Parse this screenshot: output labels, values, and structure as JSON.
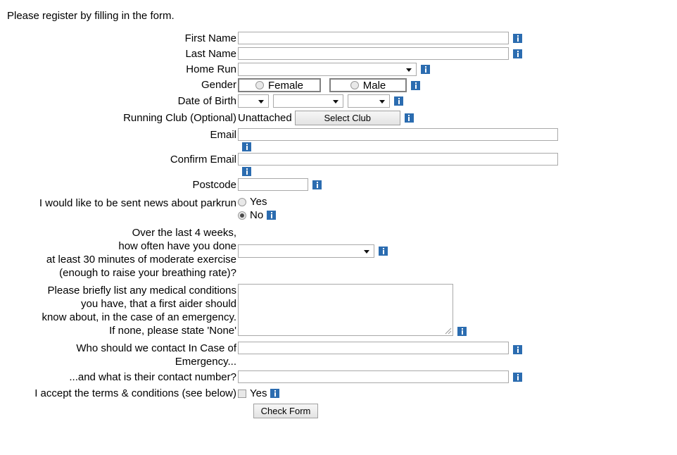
{
  "page": {
    "intro": "Please register by filling in the form."
  },
  "fields": {
    "first_name": {
      "label": "First Name",
      "value": "",
      "info": "info-icon"
    },
    "last_name": {
      "label": "Last Name",
      "value": ""
    },
    "home_run": {
      "label": "Home Run",
      "selected": ""
    },
    "gender": {
      "label": "Gender",
      "options": [
        {
          "label": "Female",
          "checked": false
        },
        {
          "label": "Male",
          "checked": false
        }
      ]
    },
    "date_of_birth": {
      "label": "Date of Birth",
      "day": "",
      "month": "",
      "year": ""
    },
    "running_club": {
      "label": "Running Club (Optional)",
      "value": "Unattached",
      "button": "Select Club"
    },
    "email": {
      "label": "Email",
      "value": ""
    },
    "confirm_email": {
      "label": "Confirm Email",
      "value": ""
    },
    "postcode": {
      "label": "Postcode",
      "value": ""
    },
    "newsletter": {
      "label": "I would like to be sent news about parkrun",
      "options": [
        {
          "label": "Yes",
          "checked": false
        },
        {
          "label": "No",
          "checked": true
        }
      ]
    },
    "exercise": {
      "label": "Over the last 4 weeks,\nhow often have you done\nat least 30 minutes of moderate exercise\n(enough to raise your breathing rate)?",
      "selected": ""
    },
    "medical": {
      "label": "Please briefly list any medical conditions\nyou have, that a first aider should\nknow about, in the case of an emergency.\nIf none, please state 'None'",
      "value": ""
    },
    "emergency_contact": {
      "label": "Who should we contact In Case of\nEmergency...",
      "value": ""
    },
    "emergency_number": {
      "label": "...and what is their contact number?",
      "value": ""
    },
    "terms": {
      "label": "I accept the terms & conditions (see below)",
      "option_label": "Yes",
      "checked": false
    }
  },
  "actions": {
    "check_form": "Check Form"
  },
  "colors": {
    "info_badge": "#2b6cb0",
    "field_border": "#a9a9a9",
    "gender_border": "#808080",
    "text": "#000000"
  }
}
